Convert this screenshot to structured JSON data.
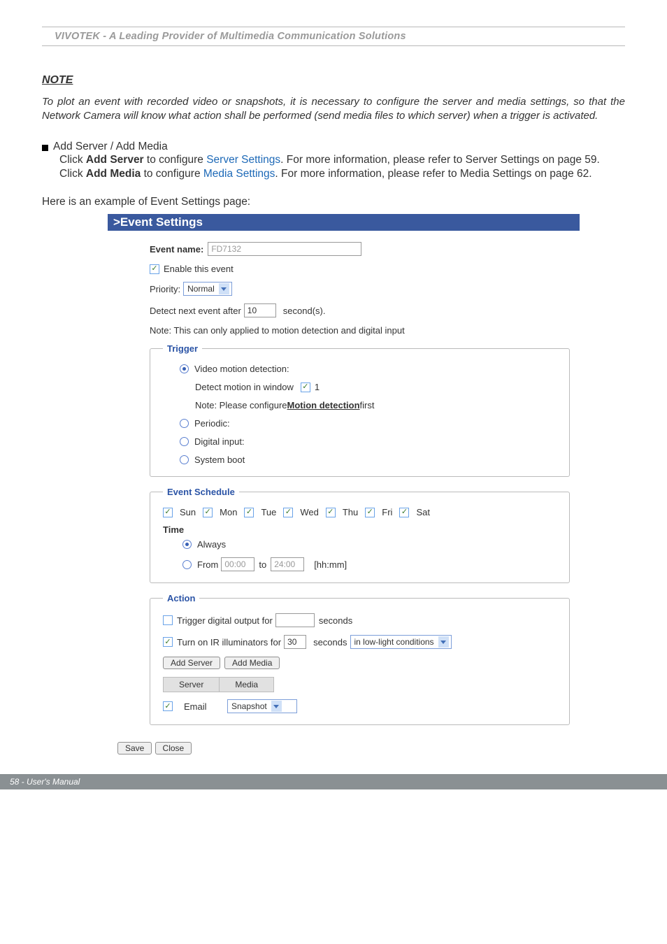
{
  "header": {
    "title": "VIVOTEK - A Leading Provider of Multimedia Communication Solutions"
  },
  "note": {
    "heading": "NOTE",
    "body": "To plot an event with recorded video or snapshots, it is necessary to configure the server and media settings, so that the Network Camera will know what action shall be performed (send media files to which server) when a trigger is activated."
  },
  "addsrv": {
    "bullet_title": "Add Server / Add Media",
    "p1_a": "Click ",
    "p1_b": "Add Server",
    "p1_c": " to configure ",
    "p1_link": "Server Settings",
    "p1_d": ". For more information, please refer to Server Settings on page 59.",
    "p2_a": "Click ",
    "p2_b": "Add Media",
    "p2_c": " to configure ",
    "p2_link": "Media Settings",
    "p2_d": ". For more information, please refer to Media Settings on page 62."
  },
  "example_intro": "Here is an example of Event Settings page:",
  "panel": {
    "title": ">Event Settings",
    "event_name_label": "Event name:",
    "event_name_value": "FD7132",
    "enable_label": "Enable this event",
    "priority_label": "Priority:",
    "priority_value": "Normal",
    "detect_label_a": "Detect next event after",
    "detect_value": "10",
    "detect_label_b": "second(s).",
    "detect_note": "Note: This can only applied to motion detection and digital input",
    "trigger": {
      "legend": "Trigger",
      "opt_video": "Video motion detection:",
      "detect_window_a": "Detect motion in window",
      "detect_window_b": "1",
      "motion_note_a": "Note: Please configure ",
      "motion_link": "Motion detection",
      "motion_note_b": " first",
      "opt_periodic": "Periodic:",
      "opt_digital": "Digital input:",
      "opt_boot": "System boot"
    },
    "schedule": {
      "legend": "Event Schedule",
      "days": [
        "Sun",
        "Mon",
        "Tue",
        "Wed",
        "Thu",
        "Fri",
        "Sat"
      ],
      "time_label": "Time",
      "always": "Always",
      "from_label": "From",
      "from_value": "00:00",
      "to_label": "to",
      "to_value": "24:00",
      "fmt": "[hh:mm]"
    },
    "action": {
      "legend": "Action",
      "trig_do_a": "Trigger digital output for",
      "trig_do_b": "seconds",
      "ir_a": "Turn on IR illuminators for",
      "ir_val": "30",
      "ir_b": "seconds",
      "ir_cond": "in low-light conditions",
      "add_server": "Add Server",
      "add_media": "Add Media",
      "th_server": "Server",
      "th_media": "Media",
      "row_email": "Email",
      "row_media_sel": "Snapshot"
    },
    "save": "Save",
    "close": "Close"
  },
  "footer": {
    "text": "58 - User's Manual"
  }
}
